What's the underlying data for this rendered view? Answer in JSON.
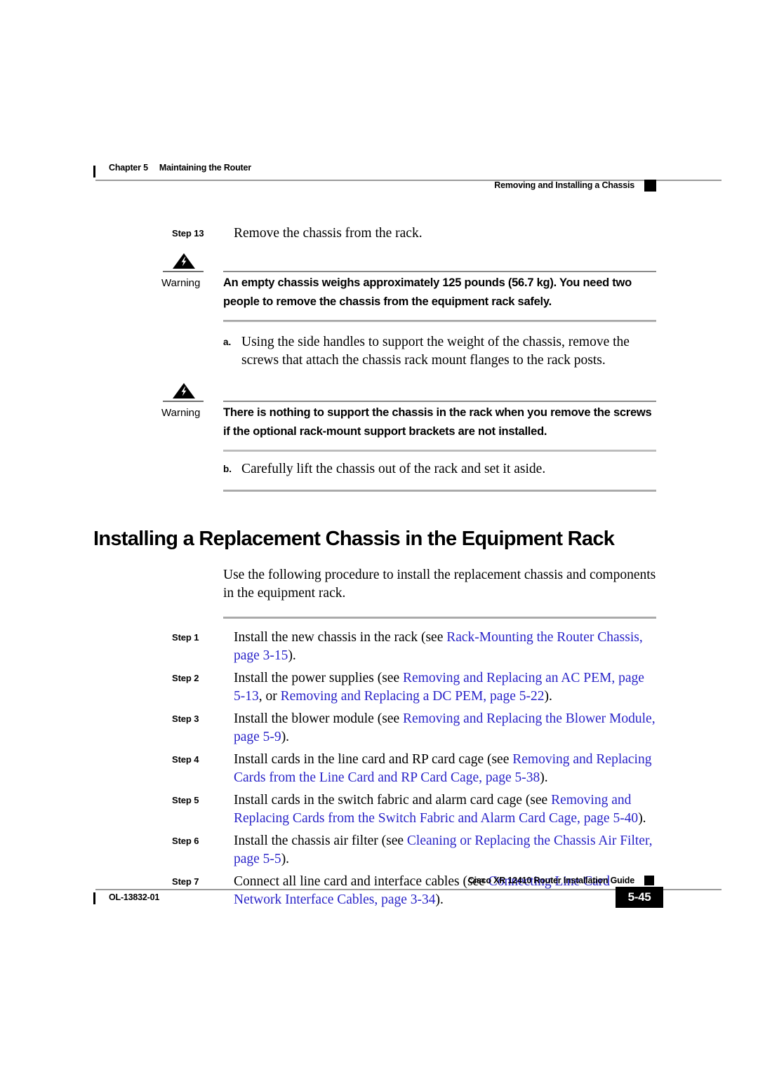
{
  "header": {
    "chapter_label": "Chapter",
    "chapter_number": "5",
    "chapter_title": "Maintaining the Router",
    "section_title": "Removing and Installing a Chassis"
  },
  "colors": {
    "link": "#2a24c8",
    "rule_gray": "#b3b3b3",
    "text": "#000000"
  },
  "top_procedure": {
    "step13": {
      "label": "Step 13",
      "text": "Remove the chassis from the rack."
    },
    "warning1": {
      "label": "Warning",
      "icon": "warning-triangle-icon",
      "text": "An empty chassis weighs approximately 125 pounds (56.7 kg). You need two people to remove the chassis from the equipment rack safely."
    },
    "item_a": {
      "marker": "a.",
      "text": "Using the side handles to support the weight of the chassis, remove the screws that attach the chassis rack mount flanges to the rack posts."
    },
    "warning2": {
      "label": "Warning",
      "icon": "warning-triangle-icon",
      "text": "There is nothing to support the chassis in the rack when you remove the screws if the optional rack-mount support brackets are not installed."
    },
    "item_b": {
      "marker": "b.",
      "text": "Carefully lift the chassis out of the rack and set it aside."
    }
  },
  "section": {
    "heading": "Installing a Replacement Chassis in the Equipment Rack",
    "intro": "Use the following procedure to install the replacement chassis and components in the equipment rack."
  },
  "steps": [
    {
      "label": "Step 1",
      "parts": [
        {
          "type": "text",
          "value": "Install the new chassis in the rack (see "
        },
        {
          "type": "link",
          "value": "Rack-Mounting the Router Chassis, page 3-15"
        },
        {
          "type": "text",
          "value": ")."
        }
      ]
    },
    {
      "label": "Step 2",
      "parts": [
        {
          "type": "text",
          "value": "Install the power supplies (see "
        },
        {
          "type": "link",
          "value": "Removing and Replacing an AC PEM, page 5-13"
        },
        {
          "type": "text",
          "value": ", or "
        },
        {
          "type": "link",
          "value": "Removing and Replacing a DC PEM, page 5-22"
        },
        {
          "type": "text",
          "value": ")."
        }
      ]
    },
    {
      "label": "Step 3",
      "parts": [
        {
          "type": "text",
          "value": "Install the blower module (see "
        },
        {
          "type": "link",
          "value": "Removing and Replacing the Blower Module, page 5-9"
        },
        {
          "type": "text",
          "value": ")."
        }
      ]
    },
    {
      "label": "Step 4",
      "parts": [
        {
          "type": "text",
          "value": "Install cards in the line card and RP card cage (see "
        },
        {
          "type": "link",
          "value": "Removing and Replacing Cards from the Line Card and RP Card Cage, page 5-38"
        },
        {
          "type": "text",
          "value": ")."
        }
      ]
    },
    {
      "label": "Step 5",
      "parts": [
        {
          "type": "text",
          "value": "Install cards in the switch fabric and alarm card cage (see "
        },
        {
          "type": "link",
          "value": "Removing and Replacing Cards from the Switch Fabric and Alarm Card Cage, page 5-40"
        },
        {
          "type": "text",
          "value": ")."
        }
      ]
    },
    {
      "label": "Step 6",
      "parts": [
        {
          "type": "text",
          "value": "Install the chassis air filter (see "
        },
        {
          "type": "link",
          "value": "Cleaning or Replacing the Chassis Air Filter, page 5-5"
        },
        {
          "type": "text",
          "value": ")."
        }
      ]
    },
    {
      "label": "Step 7",
      "parts": [
        {
          "type": "text",
          "value": "Connect all line card and interface cables (see "
        },
        {
          "type": "link",
          "value": "Connecting Line Card Network Interface Cables, page 3-34"
        },
        {
          "type": "text",
          "value": ")."
        }
      ]
    }
  ],
  "footer": {
    "guide_title": "Cisco XR 12410 Router Installation Guide",
    "doc_id": "OL-13832-01",
    "page_number": "5-45"
  }
}
